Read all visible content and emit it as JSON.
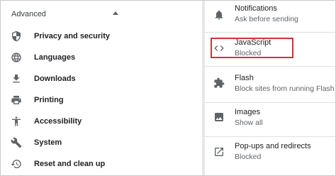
{
  "sidebar": {
    "section_label": "Advanced",
    "items": [
      {
        "label": "Privacy and security",
        "icon": "shield-icon"
      },
      {
        "label": "Languages",
        "icon": "globe-icon"
      },
      {
        "label": "Downloads",
        "icon": "download-icon"
      },
      {
        "label": "Printing",
        "icon": "printer-icon"
      },
      {
        "label": "Accessibility",
        "icon": "accessibility-icon"
      },
      {
        "label": "System",
        "icon": "wrench-icon"
      },
      {
        "label": "Reset and clean up",
        "icon": "restore-icon"
      }
    ]
  },
  "settings": [
    {
      "title": "Notifications",
      "status": "Ask before sending",
      "icon": "bell-icon"
    },
    {
      "title": "JavaScript",
      "status": "Blocked",
      "icon": "code-icon"
    },
    {
      "title": "Flash",
      "status": "Block sites from running Flash",
      "icon": "puzzle-icon"
    },
    {
      "title": "Images",
      "status": "Show all",
      "icon": "image-icon"
    },
    {
      "title": "Pop-ups and redirects",
      "status": "Blocked",
      "icon": "external-link-icon"
    }
  ],
  "colors": {
    "highlight": "#d0343a",
    "icon": "#5f6368"
  }
}
